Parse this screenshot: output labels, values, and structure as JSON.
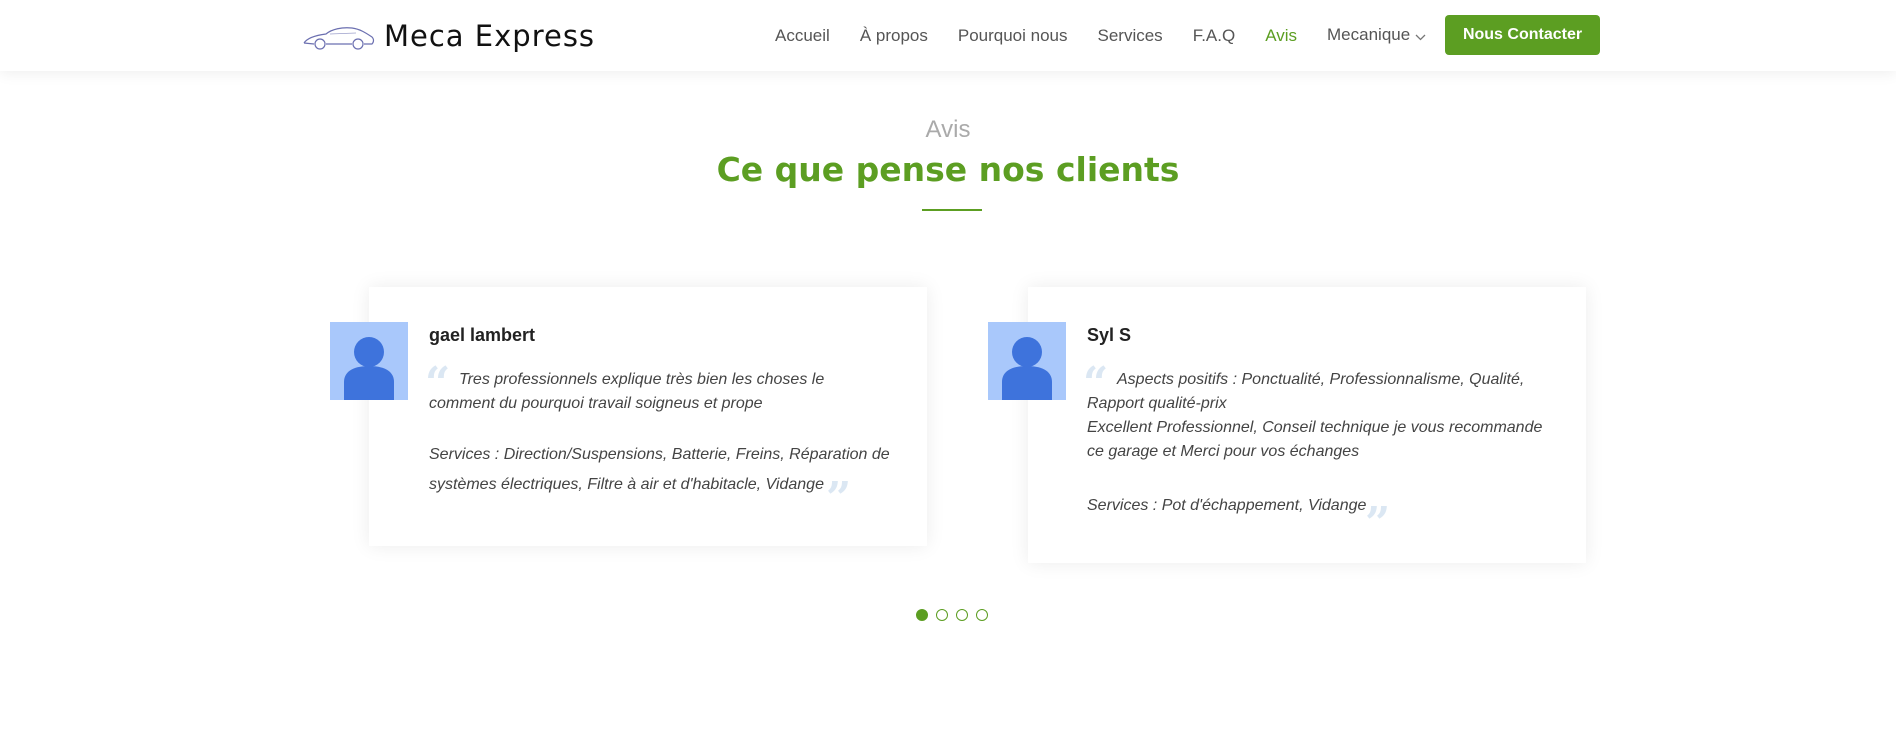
{
  "brand": {
    "name": "Meca Express",
    "accent": "#5c9e22",
    "logo_icon": "car-outline-icon"
  },
  "nav": {
    "items": [
      {
        "label": "Accueil",
        "active": false
      },
      {
        "label": "À propos",
        "active": false
      },
      {
        "label": "Pourquoi nous",
        "active": false
      },
      {
        "label": "Services",
        "active": false
      },
      {
        "label": "F.A.Q",
        "active": false
      },
      {
        "label": "Avis",
        "active": true
      },
      {
        "label": "Mecanique",
        "active": false,
        "dropdown": true
      }
    ],
    "cta_label": "Nous Contacter"
  },
  "section": {
    "subtitle": "Avis",
    "title": "Ce que pense nos clients"
  },
  "testimonials": [
    {
      "name": "gael lambert",
      "text": "Tres professionnels explique très bien les choses le comment du pourquoi travail soigneus et prope",
      "services": "Services : Direction/Suspensions, Batterie, Freins, Réparation de systèmes électriques, Filtre à air et d'habitacle, Vidange"
    },
    {
      "name": "Syl S",
      "text_line1": "Aspects positifs : Ponctualité, Professionnalisme, Qualité, Rapport qualité-prix",
      "text_line2": "Excellent Professionnel, Conseil technique je vous recommande ce garage et Merci pour vos échanges",
      "services": "Services : Pot d'échappement, Vidange"
    }
  ],
  "carousel": {
    "total": 4,
    "active_index": 0
  }
}
